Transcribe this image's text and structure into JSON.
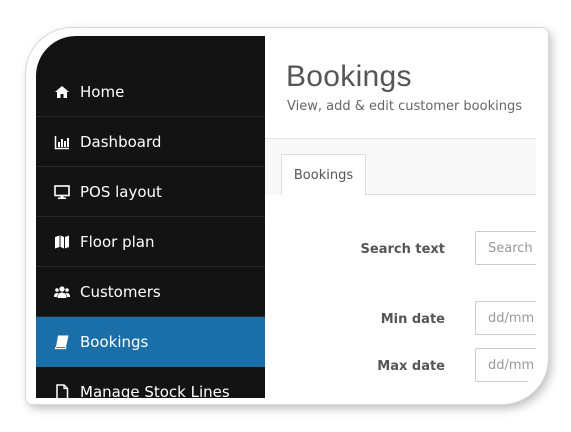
{
  "sidebar": {
    "items": [
      {
        "label": "Home",
        "icon": "home-icon",
        "active": false
      },
      {
        "label": "Dashboard",
        "icon": "bar-chart-icon",
        "active": false
      },
      {
        "label": "POS layout",
        "icon": "monitor-icon",
        "active": false
      },
      {
        "label": "Floor plan",
        "icon": "map-icon",
        "active": false
      },
      {
        "label": "Customers",
        "icon": "users-icon",
        "active": false
      },
      {
        "label": "Bookings",
        "icon": "book-icon",
        "active": true
      },
      {
        "label": "Manage Stock Lines",
        "icon": "file-icon",
        "active": false
      }
    ],
    "active_color": "#1b6fa8"
  },
  "header": {
    "title": "Bookings",
    "subtitle": "View, add & edit customer bookings",
    "accent_color": "#16a085"
  },
  "tabs": [
    {
      "label": "Bookings",
      "active": true
    }
  ],
  "form": {
    "search_label": "Search text",
    "search_placeholder": "Search t",
    "min_date_label": "Min date",
    "min_date_placeholder": "dd/mm",
    "max_date_label": "Max date",
    "max_date_placeholder": "dd/mm"
  }
}
